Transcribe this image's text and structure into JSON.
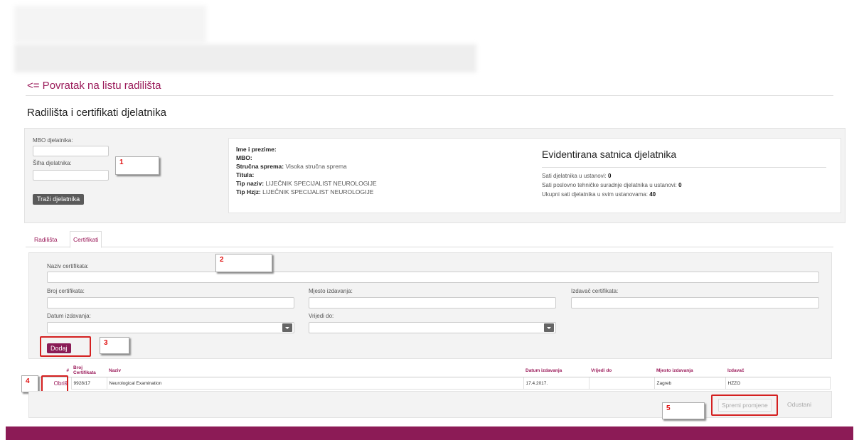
{
  "nav": {
    "back_link": "<= Povratak na listu radilišta"
  },
  "page": {
    "title": "Radilišta i certifikati djelatnika"
  },
  "search": {
    "mbo_label": "MBO djelatnika:",
    "sifra_label": "Šifra djelatnika:",
    "search_button": "Traži djelatnika"
  },
  "employee": {
    "ime_label": "Ime i prezime:",
    "mbo_label": "MBO:",
    "sprema_label": "Stručna sprema:",
    "sprema_value": "Visoka stručna sprema",
    "titula_label": "Titula:",
    "tip_naziv_label": "Tip naziv:",
    "tip_naziv_value": "LIJEČNIK SPECIJALIST NEUROLOGIJE",
    "tip_hzjz_label": "Tip Hzjz:",
    "tip_hzjz_value": "LIJEČNIK SPECIJALIST NEUROLOGIJE"
  },
  "satnica": {
    "title": "Evidentirana satnica djelatnika",
    "sati_ustanovi_label": "Sati djelatnika u ustanovi:",
    "sati_ustanovi_value": "0",
    "sati_poslovno_label": "Sati poslovno tehničke suradnje djelatnika u ustanovi:",
    "sati_poslovno_value": "0",
    "ukupni_label": "Ukupni sati djelatnika u svim ustanovama:",
    "ukupni_value": "40"
  },
  "tabs": [
    {
      "label": "Radilišta"
    },
    {
      "label": "Certifikati"
    }
  ],
  "cert_form": {
    "naziv_label": "Naziv certifikata:",
    "broj_label": "Broj certifikata:",
    "mjesto_label": "Mjesto izdavanja:",
    "izdavac_label": "Izdavač certifikata:",
    "datum_label": "Datum izdavanja:",
    "vrijedi_label": "Vrijedi do:",
    "add_button": "Dodaj"
  },
  "table": {
    "headers": [
      "#",
      "Broj Certifikata",
      "Naziv",
      "Datum izdavanja",
      "Vrijedi do",
      "Mjesto izdavanja",
      "Izdavač"
    ],
    "rows": [
      {
        "action": "Obriši",
        "broj": "9928/17",
        "naziv": "Neurological Examination",
        "datum": "17.4.2017.",
        "vrijedi": "",
        "mjesto": "Zagreb",
        "izdavac": "HZZO"
      }
    ]
  },
  "footer": {
    "save_button": "Spremi promjene",
    "cancel_button": "Odustani"
  },
  "callouts": [
    "1",
    "2",
    "3",
    "4",
    "5"
  ],
  "colors": {
    "accent": "#8c1b56",
    "link": "#9b1b5a",
    "callout_text": "#e01010",
    "highlight_frame": "#d42020"
  }
}
